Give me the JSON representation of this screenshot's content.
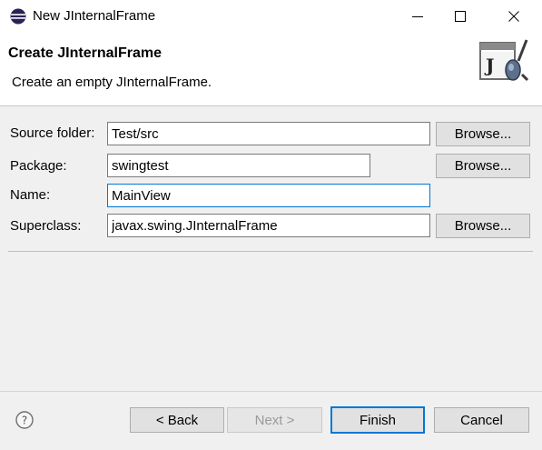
{
  "window": {
    "title": "New JInternalFrame",
    "controls": [
      "minimize-icon",
      "maximize-icon",
      "close-icon"
    ]
  },
  "banner": {
    "title": "Create JInternalFrame",
    "description": "Create an empty JInternalFrame.",
    "icon": "jinternalframe-wizard-icon"
  },
  "form": {
    "source_folder": {
      "label": "Source folder:",
      "value": "Test/src",
      "browse": "Browse..."
    },
    "package": {
      "label": "Package:",
      "value": "swingtest",
      "browse": "Browse..."
    },
    "name": {
      "label": "Name:",
      "value": "MainView"
    },
    "superclass": {
      "label": "Superclass:",
      "value": "javax.swing.JInternalFrame",
      "browse": "Browse..."
    }
  },
  "footer": {
    "help_icon": "help-icon",
    "back": "< Back",
    "next": "Next >",
    "finish": "Finish",
    "cancel": "Cancel"
  },
  "colors": {
    "accent": "#0078d7",
    "background": "#f0f0f0",
    "button": "#e1e1e1"
  }
}
